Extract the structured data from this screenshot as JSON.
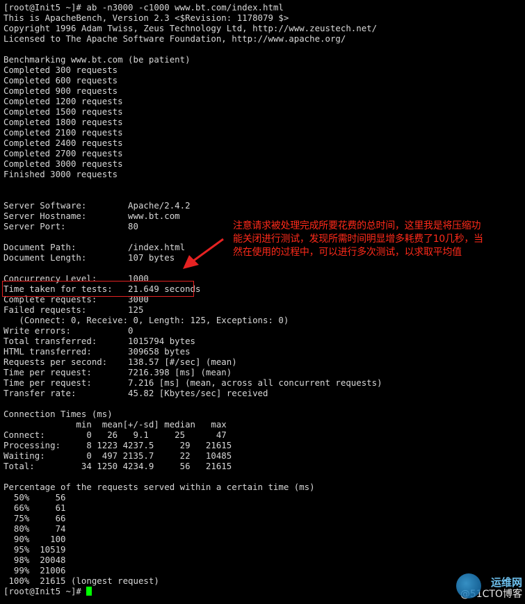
{
  "terminal": {
    "lines": [
      "[root@Init5 ~]# ab -n3000 -c1000 www.bt.com/index.html",
      "This is ApacheBench, Version 2.3 <$Revision: 1178079 $>",
      "Copyright 1996 Adam Twiss, Zeus Technology Ltd, http://www.zeustech.net/",
      "Licensed to The Apache Software Foundation, http://www.apache.org/",
      "",
      "Benchmarking www.bt.com (be patient)",
      "Completed 300 requests",
      "Completed 600 requests",
      "Completed 900 requests",
      "Completed 1200 requests",
      "Completed 1500 requests",
      "Completed 1800 requests",
      "Completed 2100 requests",
      "Completed 2400 requests",
      "Completed 2700 requests",
      "Completed 3000 requests",
      "Finished 3000 requests",
      "",
      "",
      "Server Software:        Apache/2.4.2",
      "Server Hostname:        www.bt.com",
      "Server Port:            80",
      "",
      "Document Path:          /index.html",
      "Document Length:        107 bytes",
      "",
      "Concurrency Level:      1000",
      "Time taken for tests:   21.649 seconds",
      "Complete requests:      3000",
      "Failed requests:        125",
      "   (Connect: 0, Receive: 0, Length: 125, Exceptions: 0)",
      "Write errors:           0",
      "Total transferred:      1015794 bytes",
      "HTML transferred:       309658 bytes",
      "Requests per second:    138.57 [#/sec] (mean)",
      "Time per request:       7216.398 [ms] (mean)",
      "Time per request:       7.216 [ms] (mean, across all concurrent requests)",
      "Transfer rate:          45.82 [Kbytes/sec] received",
      "",
      "Connection Times (ms)",
      "              min  mean[+/-sd] median   max",
      "Connect:        0   26   9.1     25      47",
      "Processing:     8 1223 4237.5     29   21615",
      "Waiting:        0  497 2135.7     22   10485",
      "Total:         34 1250 4234.9     56   21615",
      "",
      "Percentage of the requests served within a certain time (ms)",
      "  50%     56",
      "  66%     61",
      "  75%     66",
      "  80%     74",
      "  90%    100",
      "  95%  10519",
      "  98%  20048",
      "  99%  21006",
      " 100%  21615 (longest request)"
    ],
    "prompt": "[root@Init5 ~]# "
  },
  "annotation": {
    "lines": [
      "注意请求被处理完成所要花费的总时间，这里我是将压缩功",
      "能关闭进行测试，发现所需时间明显增多耗费了10几秒，当",
      "然在使用的过程中，可以进行多次测试，以求取平均值"
    ]
  },
  "watermark": {
    "top": "运维网",
    "bottom": "@51CTO博客"
  },
  "colors": {
    "background": "#000000",
    "text": "#d8d8d8",
    "annotation": "#ff2a1a",
    "cursor": "#00ff00"
  }
}
